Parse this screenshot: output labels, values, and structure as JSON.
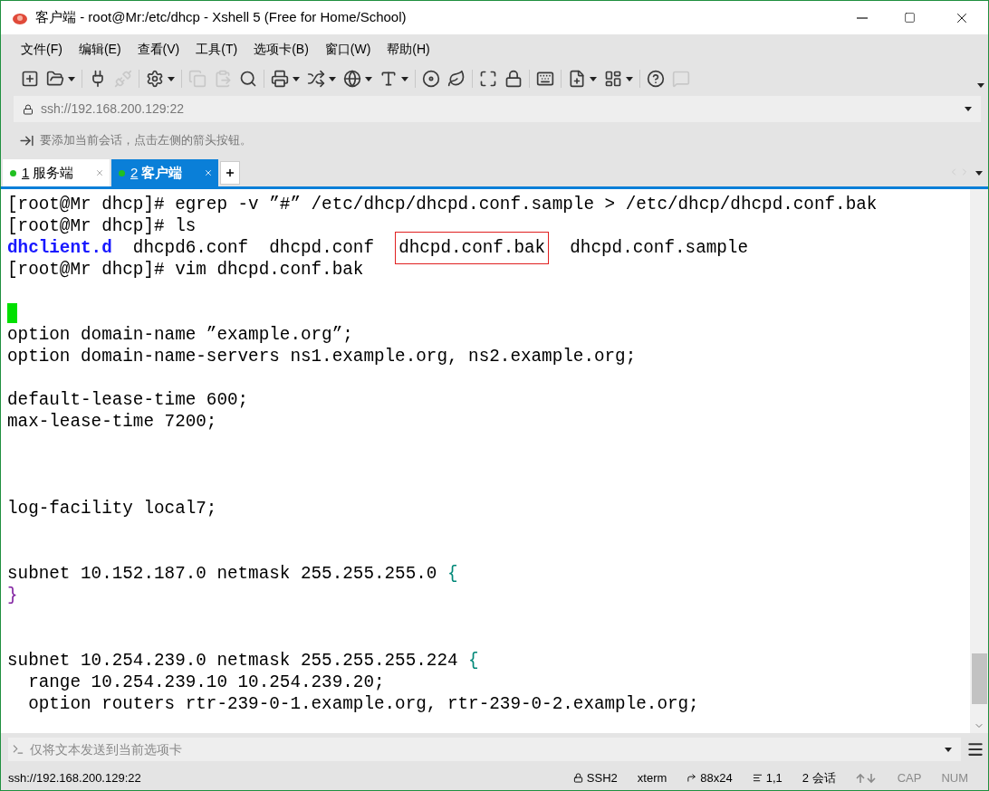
{
  "window": {
    "title": "客户端 - root@Mr:/etc/dhcp - Xshell 5 (Free for Home/School)"
  },
  "menu": [
    "文件(F)",
    "编辑(E)",
    "查看(V)",
    "工具(T)",
    "选项卡(B)",
    "窗口(W)",
    "帮助(H)"
  ],
  "address_bar": {
    "value": "ssh://192.168.200.129:22"
  },
  "hint_bar": {
    "text": "要添加当前会话，点击左侧的箭头按钮。"
  },
  "tabs": [
    {
      "number": "1",
      "label": "服务端",
      "selected": false
    },
    {
      "number": "2",
      "label": "客户端",
      "selected": true
    }
  ],
  "terminal": {
    "lines": [
      {
        "segments": [
          {
            "kind": "plain",
            "text": "[root@Mr dhcp]# egrep -v ”#” /etc/dhcp/dhcpd.conf.sample > /etc/dhcp/dhcpd.conf.bak"
          }
        ]
      },
      {
        "segments": [
          {
            "kind": "plain",
            "text": "[root@Mr dhcp]# ls"
          }
        ]
      },
      {
        "segments": [
          {
            "kind": "dir",
            "text": "dhclient.d"
          },
          {
            "kind": "plain",
            "text": "  dhcpd6.conf  dhcpd.conf  "
          },
          {
            "kind": "boxed",
            "text": "dhcpd.conf.bak"
          },
          {
            "kind": "plain",
            "text": "  dhcpd.conf.sample"
          }
        ]
      },
      {
        "segments": [
          {
            "kind": "plain",
            "text": "[root@Mr dhcp]# vim dhcpd.conf.bak"
          }
        ]
      },
      {
        "kind": "blank"
      },
      {
        "kind": "cursor"
      },
      {
        "segments": [
          {
            "kind": "plain",
            "text": "option domain-name ”example.org”;"
          }
        ]
      },
      {
        "segments": [
          {
            "kind": "plain",
            "text": "option domain-name-servers ns1.example.org, ns2.example.org;"
          }
        ]
      },
      {
        "kind": "blank"
      },
      {
        "segments": [
          {
            "kind": "plain",
            "text": "default-lease-time 600;"
          }
        ]
      },
      {
        "segments": [
          {
            "kind": "plain",
            "text": "max-lease-time 7200;"
          }
        ]
      },
      {
        "kind": "blank"
      },
      {
        "kind": "blank"
      },
      {
        "kind": "blank"
      },
      {
        "segments": [
          {
            "kind": "plain",
            "text": "log-facility local7;"
          }
        ]
      },
      {
        "kind": "blank"
      },
      {
        "kind": "blank"
      },
      {
        "segments": [
          {
            "kind": "plain",
            "text": "subnet 10.152.187.0 netmask 255.255.255.0 "
          },
          {
            "kind": "open-brace",
            "text": "{"
          }
        ]
      },
      {
        "segments": [
          {
            "kind": "close-brace",
            "text": "}"
          }
        ]
      },
      {
        "kind": "blank"
      },
      {
        "kind": "blank"
      },
      {
        "segments": [
          {
            "kind": "plain",
            "text": "subnet 10.254.239.0 netmask 255.255.255.224 "
          },
          {
            "kind": "open-brace",
            "text": "{"
          }
        ]
      },
      {
        "segments": [
          {
            "kind": "plain",
            "text": "  range 10.254.239.10 10.254.239.20;"
          }
        ]
      },
      {
        "segments": [
          {
            "kind": "plain",
            "text": "  option routers rtr-239-0-1.example.org, rtr-239-0-2.example.org;"
          }
        ]
      }
    ]
  },
  "send_bar": {
    "placeholder": "仅将文本发送到当前选项卡"
  },
  "status_bar": {
    "address": "ssh://192.168.200.129:22",
    "items": [
      {
        "kind": "protocol",
        "text": "SSH2",
        "on": true
      },
      {
        "kind": "plain",
        "text": "xterm",
        "on": true
      },
      {
        "kind": "size",
        "text": "88x24",
        "on": true
      },
      {
        "kind": "cursor",
        "text": "1,1",
        "on": true
      },
      {
        "kind": "plain",
        "text": "2 会话",
        "on": true
      },
      {
        "kind": "arrows",
        "on": false
      },
      {
        "kind": "plain",
        "text": "CAP",
        "on": false
      },
      {
        "kind": "plain",
        "text": "NUM",
        "on": false
      }
    ]
  }
}
